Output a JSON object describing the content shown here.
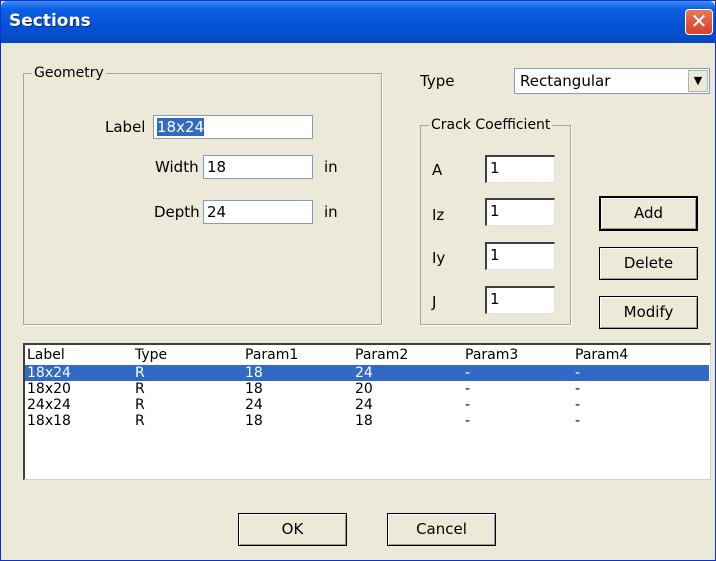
{
  "window": {
    "title": "Sections"
  },
  "geometry": {
    "legend": "Geometry",
    "label_caption": "Label",
    "label_value": "18x24",
    "width_caption": "Width",
    "width_value": "18",
    "width_unit": "in",
    "depth_caption": "Depth",
    "depth_value": "24",
    "depth_unit": "in"
  },
  "type": {
    "caption": "Type",
    "selected": "Rectangular"
  },
  "crack": {
    "legend": "Crack Coefficient",
    "rows": [
      {
        "label": "A",
        "value": "1"
      },
      {
        "label": "Iz",
        "value": "1"
      },
      {
        "label": "Iy",
        "value": "1"
      },
      {
        "label": "J",
        "value": "1"
      }
    ]
  },
  "buttons": {
    "add": "Add",
    "delete": "Delete",
    "modify": "Modify",
    "ok": "OK",
    "cancel": "Cancel"
  },
  "table": {
    "columns": [
      "Label",
      "Type",
      "Param1",
      "Param2",
      "Param3",
      "Param4"
    ],
    "rows": [
      [
        "18x24",
        "R",
        "18",
        "24",
        "-",
        "-"
      ],
      [
        "18x20",
        "R",
        "18",
        "20",
        "-",
        "-"
      ],
      [
        "24x24",
        "R",
        "24",
        "24",
        "-",
        "-"
      ],
      [
        "18x18",
        "R",
        "18",
        "18",
        "-",
        "-"
      ]
    ],
    "selected_index": 0
  }
}
